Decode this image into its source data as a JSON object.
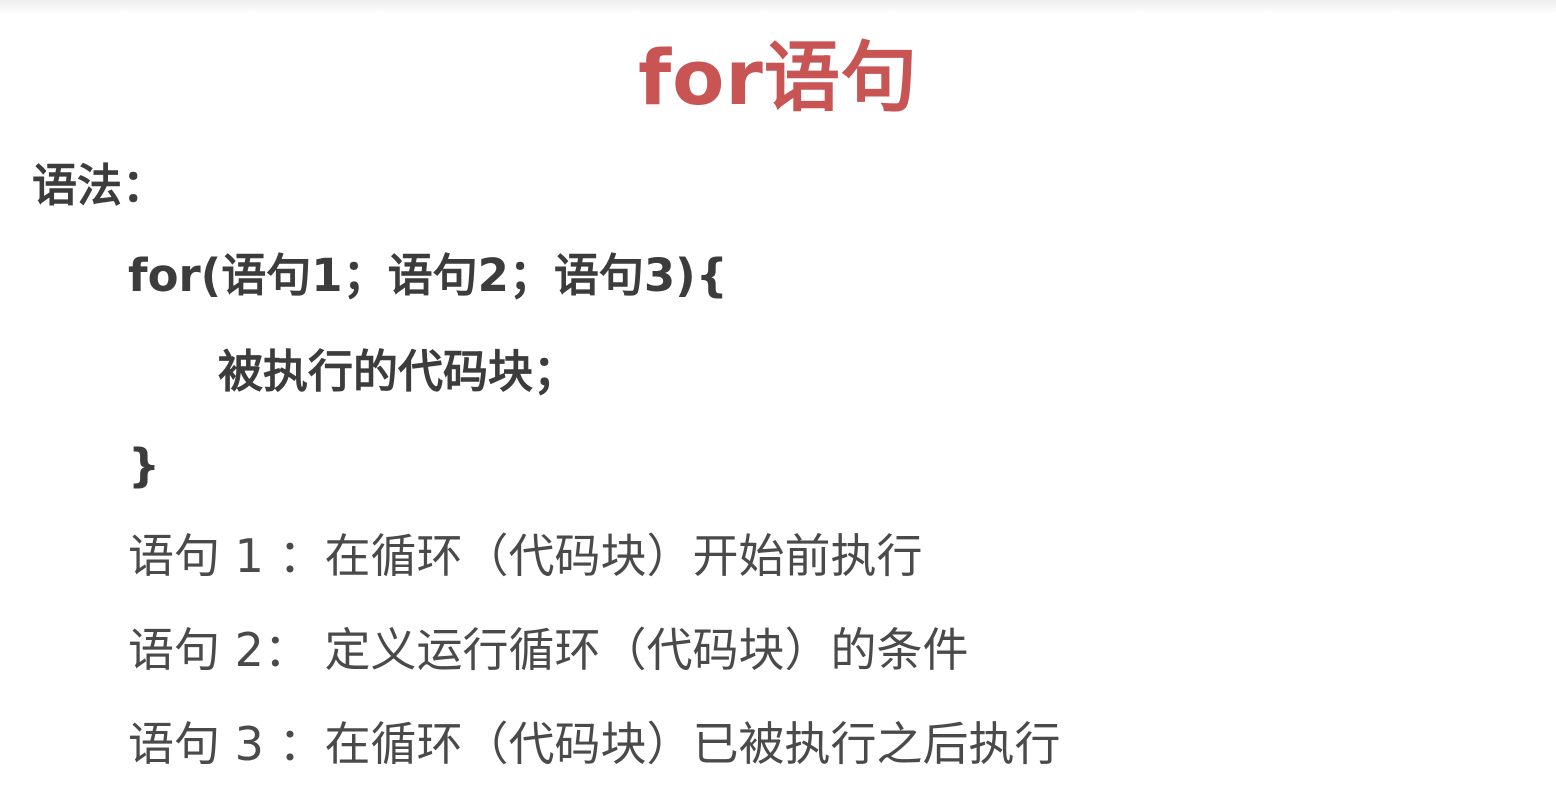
{
  "slide": {
    "title": "for语句",
    "syntax_label": "语法：",
    "code": {
      "open_line": "for(语句1；语句2；语句3){",
      "body_line": "被执行的代码块；",
      "close_line": "}"
    },
    "descriptions": [
      "语句 1 ：在循环（代码块）开始前执行",
      "语句 2： 定义运行循环（代码块）的条件",
      "语句 3 ：在循环（代码块）已被执行之后执行"
    ]
  },
  "colors": {
    "title": "#c85454",
    "text": "#3c3c3c",
    "background": "#ffffff"
  }
}
